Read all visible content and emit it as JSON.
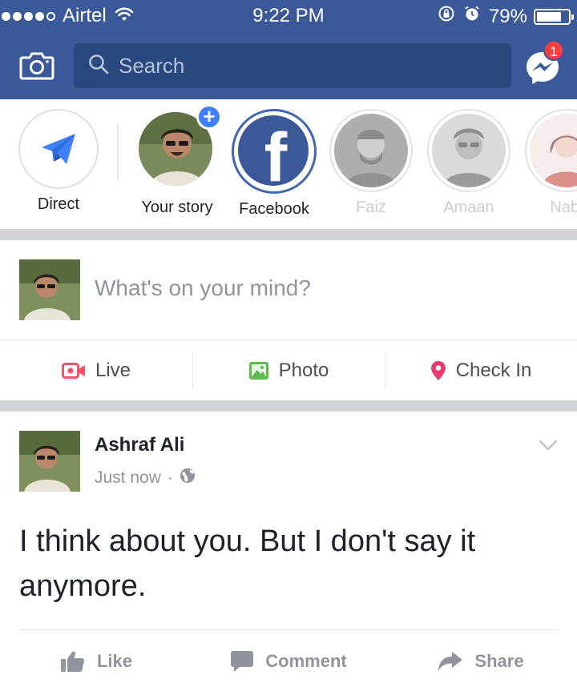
{
  "status_bar": {
    "carrier": "Airtel",
    "time": "9:22 PM",
    "battery_percent": "79%",
    "battery_level": 0.79
  },
  "header": {
    "search_placeholder": "Search",
    "messenger_badge": "1",
    "bar_color": "#3b5998"
  },
  "stories": [
    {
      "label": "Direct",
      "icon": "paper-plane-icon"
    },
    {
      "label": "Your story",
      "icon": "plus-icon"
    },
    {
      "label": "Facebook",
      "icon": "facebook-logo-icon"
    },
    {
      "label": "Faiz"
    },
    {
      "label": "Amaan"
    },
    {
      "label": "Nabi"
    }
  ],
  "composer": {
    "placeholder": "What's on your mind?",
    "actions": [
      {
        "label": "Live",
        "icon": "live-video-icon",
        "color": "#f35369"
      },
      {
        "label": "Photo",
        "icon": "photo-icon",
        "color": "#5dbb4b"
      },
      {
        "label": "Check In",
        "icon": "location-pin-icon",
        "color": "#e9386c"
      }
    ]
  },
  "post": {
    "author": "Ashraf Ali",
    "timestamp": "Just now",
    "separator": "·",
    "privacy_icon": "globe-icon",
    "text": "I think about you. But I don't say it anymore.",
    "actions": [
      {
        "label": "Like",
        "icon": "thumbs-up-icon"
      },
      {
        "label": "Comment",
        "icon": "comment-icon"
      },
      {
        "label": "Share",
        "icon": "share-arrow-icon"
      }
    ]
  }
}
